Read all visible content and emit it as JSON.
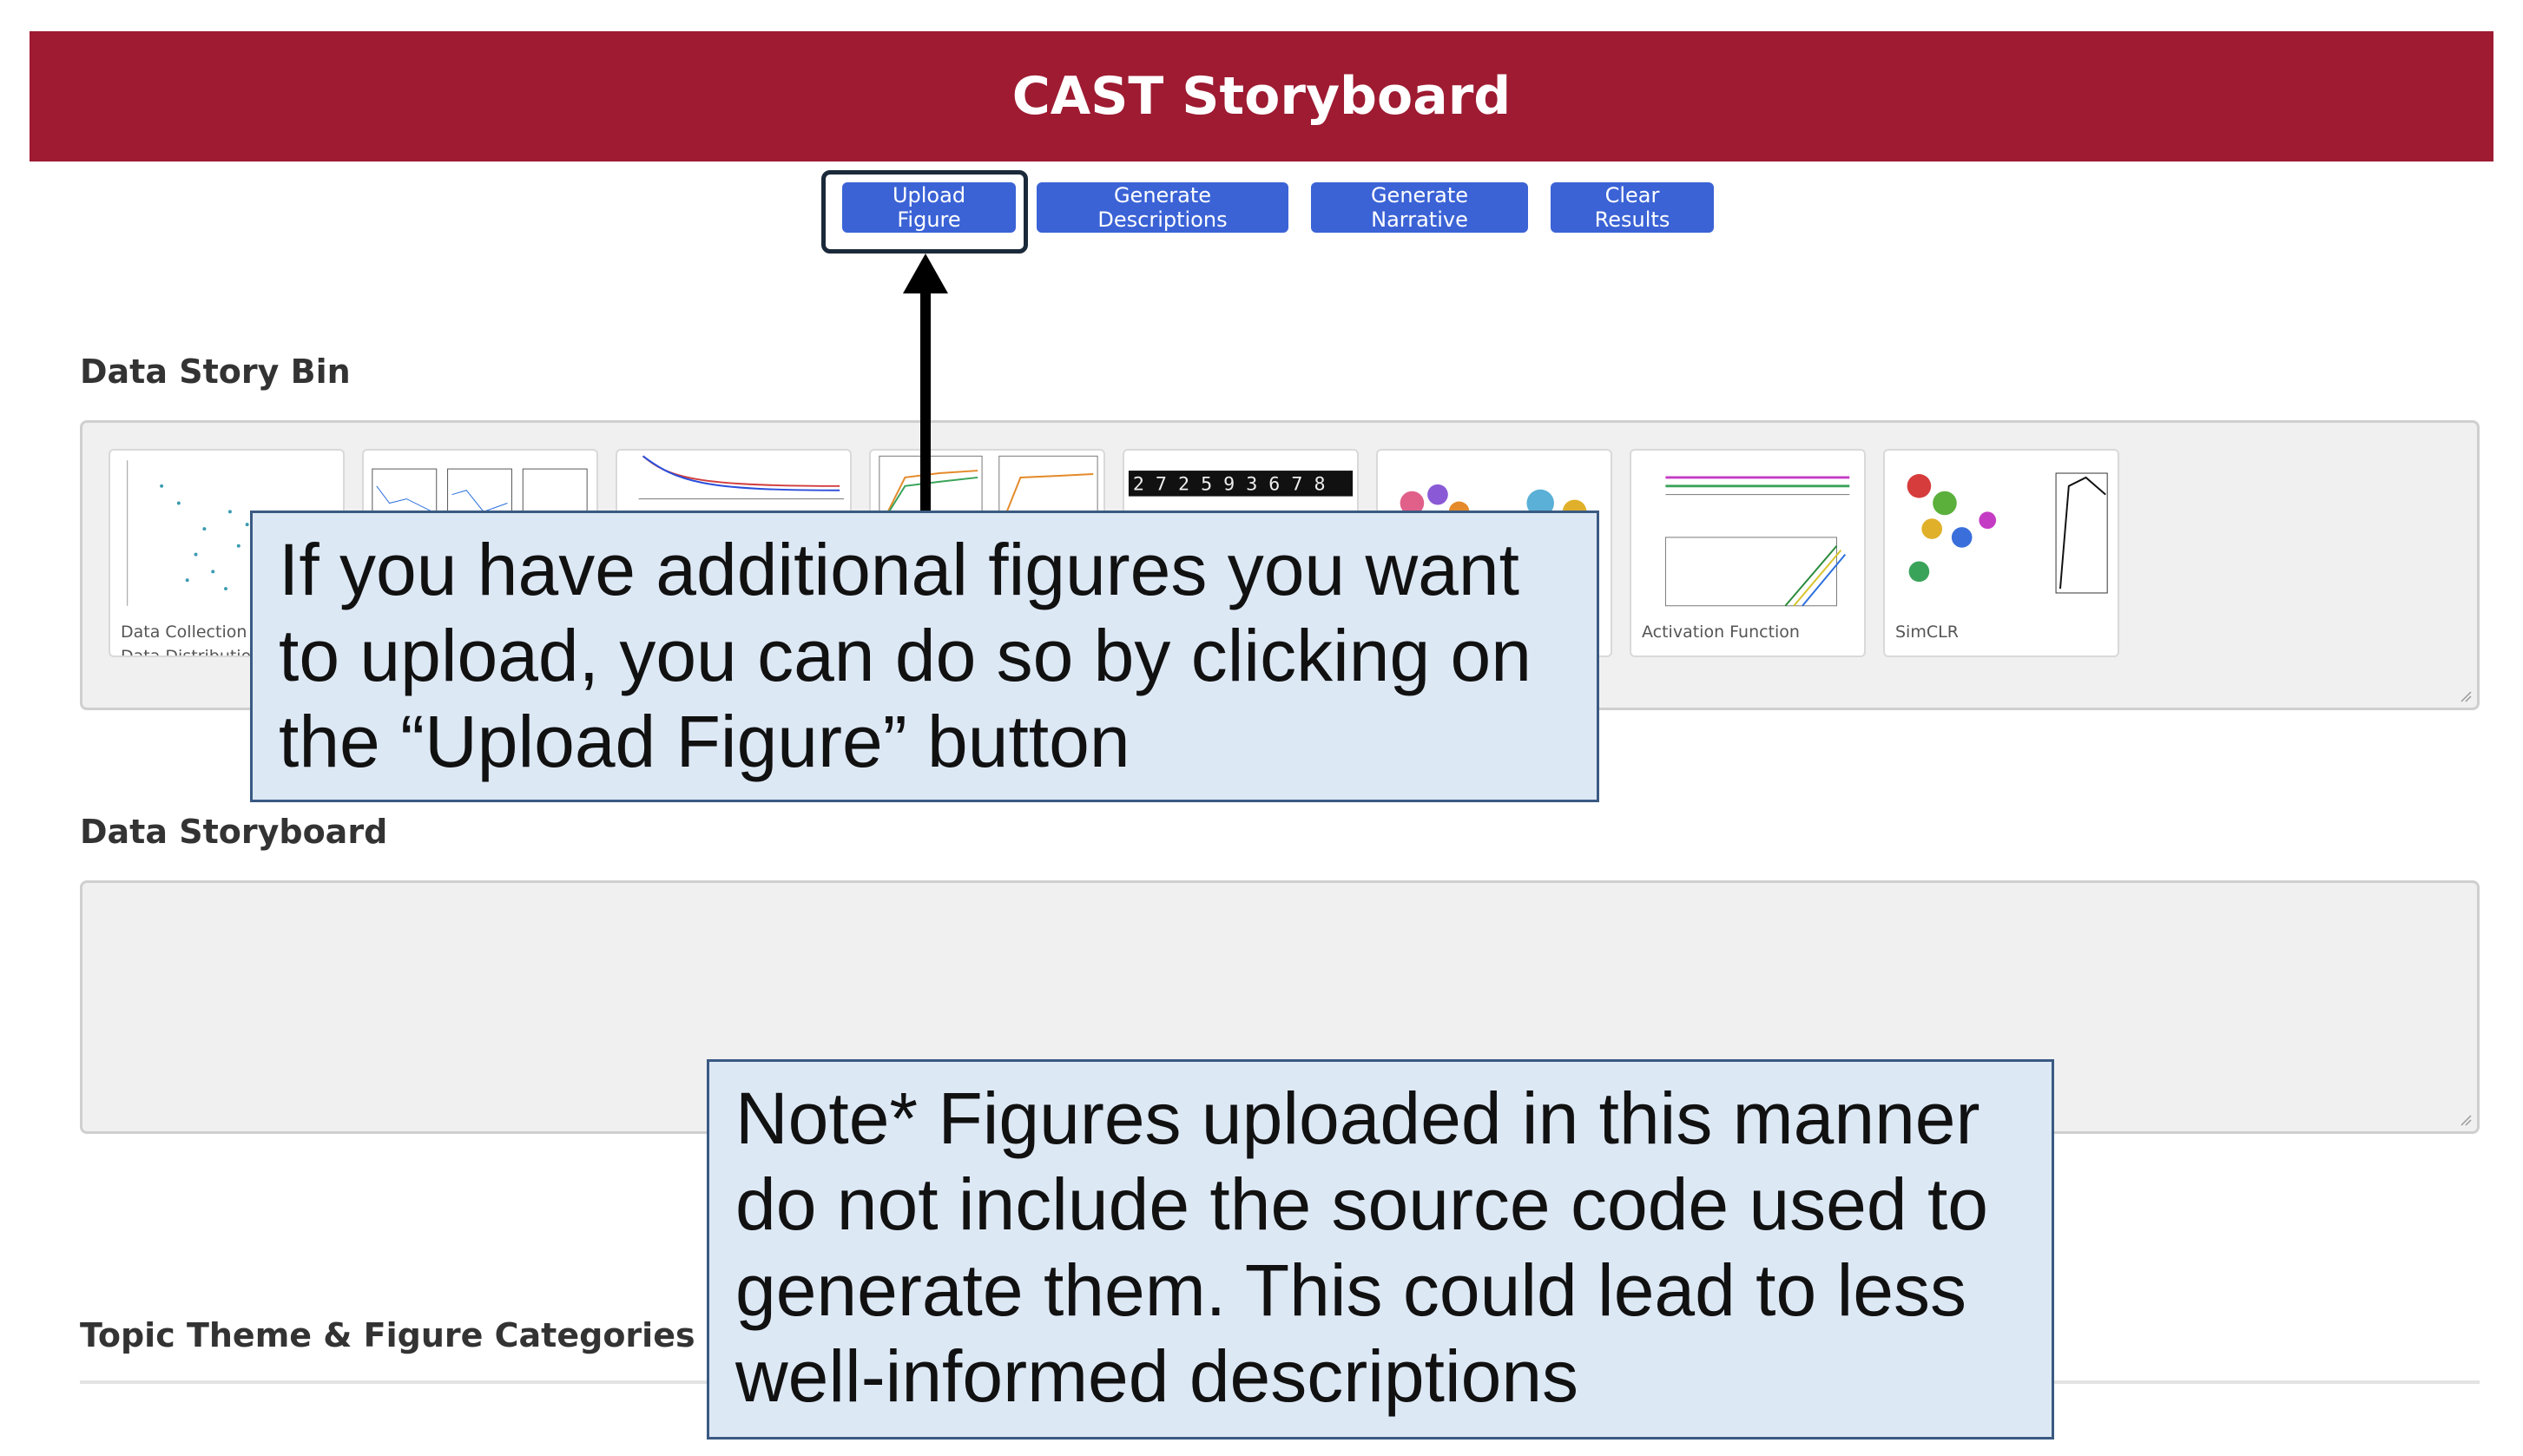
{
  "header": {
    "title": "CAST Storyboard"
  },
  "toolbar": {
    "upload_label": "Upload Figure",
    "generate_descriptions_label": "Generate Descriptions",
    "generate_narrative_label": "Generate Narrative",
    "clear_results_label": "Clear Results"
  },
  "sections": {
    "bin_title": "Data Story Bin",
    "storyboard_title": "Data Storyboard",
    "topic_title": "Topic Theme & Figure Categories"
  },
  "bin_cards": [
    {
      "label": "Data Collection -",
      "label2": "Data Distribution"
    },
    {
      "label": "",
      "label2": ""
    },
    {
      "label": "",
      "label2": ""
    },
    {
      "label": "",
      "label2": ""
    },
    {
      "label": "",
      "label2": ""
    },
    {
      "label": "",
      "label2": ""
    },
    {
      "label": "Activation Function",
      "label2": ""
    },
    {
      "label": "SimCLR",
      "label2": ""
    }
  ],
  "callouts": {
    "upload_hint": "If you have additional figures you want to upload, you can do so by clicking on the “Upload Figure” button",
    "note": "Note* Figures uploaded in this manner do not include the source code used to generate them. This could lead to less well-informed descriptions"
  },
  "colors": {
    "header_bg": "#9e1b32",
    "button_bg": "#3b63d6",
    "callout_bg": "#dde8f5",
    "callout_border": "#3a5a82"
  }
}
